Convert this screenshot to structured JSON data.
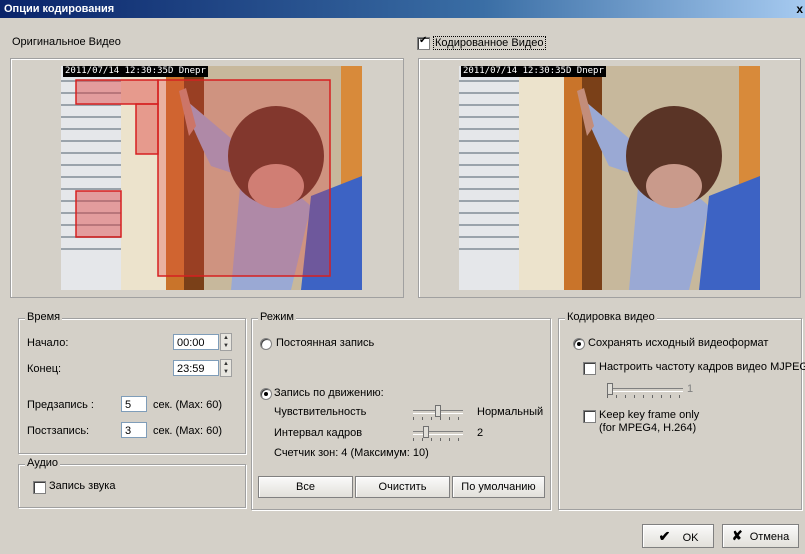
{
  "window": {
    "title": "Опции кодирования",
    "close_glyph": "x"
  },
  "original": {
    "label": "Оригинальное Видео",
    "timestamp": "2011/07/14 12:30:35D Dnepr"
  },
  "encoded": {
    "label": "Кодированное Видео",
    "checked": true,
    "timestamp": "2011/07/14 12:30:35D Dnepr"
  },
  "time": {
    "title": "Время",
    "start_label": "Начало:",
    "start_value": "00:00",
    "end_label": "Конец:",
    "end_value": "23:59",
    "prerec_label": "Предзапись :",
    "prerec_value": "5",
    "prerec_hint": "сек. (Max: 60)",
    "postrec_label": "Постзапись:",
    "postrec_value": "3",
    "postrec_hint": "сек. (Max: 60)"
  },
  "audio": {
    "title": "Аудио",
    "record_label": "Запись звука"
  },
  "mode": {
    "title": "Режим",
    "continuous_label": "Постоянная запись",
    "motion_label": "Запись по движению:",
    "sensitivity_label": "Чувствительность",
    "sensitivity_value": "Нормальный",
    "interval_label": "Интервал кадров",
    "interval_value": "2",
    "zones_label": "Счетчик зон: 4  (Максимум: 10)",
    "btn_all": "Все",
    "btn_clear": "Очистить",
    "btn_default": "По умолчанию"
  },
  "encoding": {
    "title": "Кодировка видео",
    "keep_format_label": "Сохранять исходный видеоформат",
    "mjpeg_label": "Настроить частоту кадров видео MJPEG",
    "mjpeg_slider_value": "1",
    "keyframe_label": "Keep key frame only",
    "keyframe_sub": "(for MPEG4, H.264)"
  },
  "footer": {
    "ok_label": "OK",
    "cancel_label": "Отмена"
  }
}
